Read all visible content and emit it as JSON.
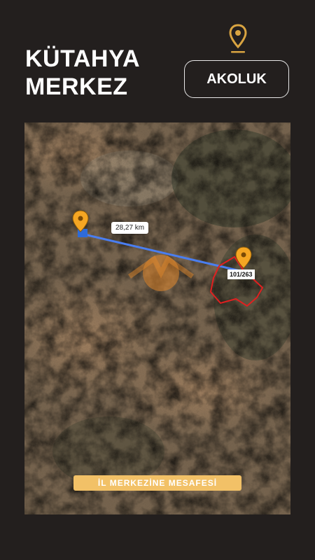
{
  "title": {
    "line1": "KÜTAHYA",
    "line2": "MERKEZ"
  },
  "location_button": {
    "label": "AKOLUK",
    "icon": "map-pin-icon"
  },
  "map": {
    "distance_label": "28,27 km",
    "parcel_label": "101/263",
    "route_color": "#4a7ef0",
    "parcel_outline_color": "#e02020",
    "marker_color": "#f5a623"
  },
  "banner": {
    "text": "İL MERKEZİNE MESAFESİ"
  },
  "colors": {
    "background": "#231f1e",
    "accent": "#f2c167",
    "pin": "#d9a441"
  }
}
